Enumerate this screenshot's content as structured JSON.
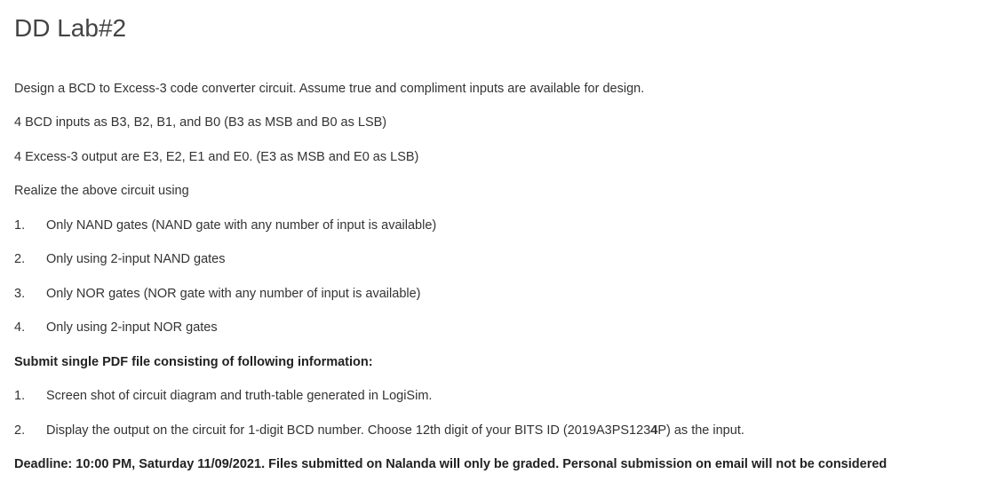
{
  "title": "DD Lab#2",
  "paragraphs": {
    "intro": "Design a BCD to Excess-3 code converter circuit. Assume true and compliment inputs are available for design.",
    "inputs": "4 BCD inputs as B3, B2, B1, and B0 (B3 as MSB and B0 as LSB)",
    "outputs": "4 Excess-3 output are E3, E2, E1 and E0. (E3 as MSB and E0 as LSB)",
    "realize": "Realize the above circuit using"
  },
  "realize_list": [
    {
      "num": "1.",
      "text": "Only NAND gates (NAND gate with any number of input is available)"
    },
    {
      "num": "2.",
      "text": "Only using 2-input NAND gates"
    },
    {
      "num": "3.",
      "text": "Only NOR gates (NOR gate with any number of input is available)"
    },
    {
      "num": "4.",
      "text": "Only using 2-input NOR gates"
    }
  ],
  "submit_heading": "Submit single PDF file consisting of following information:",
  "submit_list": [
    {
      "num": "1.",
      "text": "Screen shot of circuit diagram and truth-table generated in LogiSim."
    },
    {
      "num": "2.",
      "text_before": "Display the output on the circuit for 1-digit BCD number. Choose 12th digit of your BITS ID (2019A3PS123",
      "text_bold": "4",
      "text_after": "P) as the input."
    }
  ],
  "deadline": "Deadline: 10:00 PM, Saturday 11/09/2021. Files submitted on Nalanda will only be graded. Personal submission on email will not be considered"
}
